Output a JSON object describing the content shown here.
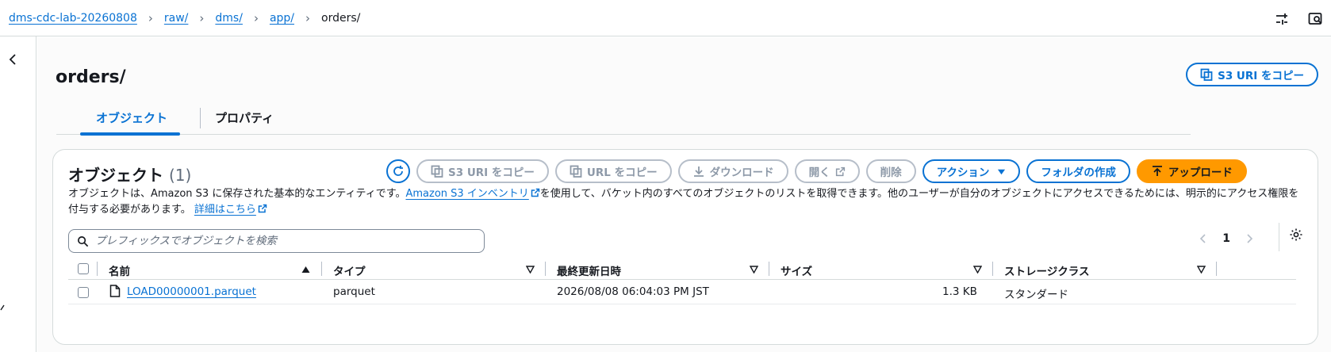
{
  "breadcrumb": {
    "items": [
      "dms-cdc-lab-20260808",
      "raw/",
      "dms/",
      "app/"
    ],
    "current": "orders/"
  },
  "page": {
    "title": "orders/",
    "copy_uri_label": "S3 URI をコピー"
  },
  "tabs": [
    {
      "label": "オブジェクト",
      "active": true
    },
    {
      "label": "プロパティ",
      "active": false
    }
  ],
  "panel": {
    "title": "オブジェクト",
    "count": "(1)",
    "toolbar": {
      "copy_s3_uri": "S3 URI をコピー",
      "copy_url": "URL をコピー",
      "download": "ダウンロード",
      "open": "開く",
      "delete": "削除",
      "actions": "アクション",
      "create_folder": "フォルダの作成",
      "upload": "アップロード"
    },
    "desc_1": "オブジェクトは、Amazon S3 に保存された基本的なエンティティです。",
    "desc_link": "Amazon S3 インベントリ",
    "desc_2": "を使用して、バケット内のすべてのオブジェクトのリストを取得できます。他のユーザーが自分のオブジェクトにアクセスできるためには、明示的にアクセス権限を付与する必要があります。",
    "learn_more": "詳細はこちら",
    "search_placeholder": "プレフィックスでオブジェクトを検索",
    "page_number": "1"
  },
  "table": {
    "columns": [
      "名前",
      "タイプ",
      "最終更新日時",
      "サイズ",
      "ストレージクラス"
    ],
    "rows": [
      {
        "name": "LOAD00000001.parquet",
        "type": "parquet",
        "modified": "2026/08/08 06:04:03 PM JST",
        "size": "1.3 KB",
        "storage": "スタンダード"
      }
    ]
  },
  "colors": {
    "link": "#0972d3",
    "upload": "#ff9900",
    "border": "#d5dbdb"
  }
}
